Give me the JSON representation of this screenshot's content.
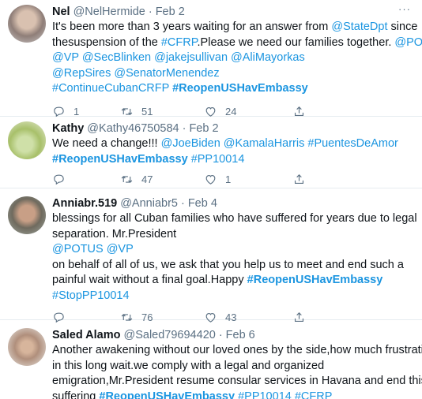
{
  "tweets": [
    {
      "name": "Nel",
      "handle": "@NelHermide",
      "date": "Feb 2",
      "lines": [
        [
          {
            "t": "It's been more than 3 years waiting for an answer from ",
            "s": "plain"
          },
          {
            "t": "@StateDpt",
            "s": "link"
          },
          {
            "t": " since",
            "s": "plain"
          }
        ],
        [
          {
            "t": "thesuspension of the ",
            "s": "plain"
          },
          {
            "t": "#CFRP",
            "s": "link"
          },
          {
            "t": ".Please we need our families together. ",
            "s": "plain"
          },
          {
            "t": "@POTUS",
            "s": "link"
          }
        ],
        [
          {
            "t": "@VP @SecBlinken @jakejsullivan @AliMayorkas",
            "s": "link"
          }
        ],
        [
          {
            "t": "@RepSires @SenatorMenendez",
            "s": "link"
          }
        ],
        [
          {
            "t": "#ContinueCubanCRFP ",
            "s": "link"
          },
          {
            "t": "#ReopenUSHavEmbassy",
            "s": "linkbold"
          }
        ]
      ],
      "replies": "1",
      "retweets": "51",
      "likes": "24"
    },
    {
      "name": "Kathy",
      "handle": "@Kathy46750584",
      "date": "Feb 2",
      "lines": [
        [
          {
            "t": "We need a change!!! ",
            "s": "plain"
          },
          {
            "t": "@JoeBiden @KamalaHarris #PuentesDeAmor",
            "s": "link"
          }
        ],
        [
          {
            "t": "#ReopenUSHavEmbassy",
            "s": "linkbold"
          },
          {
            "t": " #PP10014",
            "s": "link"
          }
        ]
      ],
      "replies": "",
      "retweets": "47",
      "likes": "1"
    },
    {
      "name": "Anniabr.519",
      "handle": "@Anniabr5",
      "date": "Feb 4",
      "lines": [
        [
          {
            "t": "blessings for all Cuban families who have suffered for years due to legal",
            "s": "plain"
          }
        ],
        [
          {
            "t": "separation. Mr.President",
            "s": "plain"
          }
        ],
        [
          {
            "t": "@POTUS    @VP",
            "s": "link"
          }
        ],
        [
          {
            "t": " on behalf of all of us, we ask that you help us to meet and end such a",
            "s": "plain"
          }
        ],
        [
          {
            "t": "painful wait without a final goal.Happy ",
            "s": "plain"
          },
          {
            "t": "#ReopenUSHavEmbassy",
            "s": "linkbold"
          }
        ],
        [
          {
            "t": "#StopPP10014",
            "s": "link"
          }
        ]
      ],
      "replies": "",
      "retweets": "76",
      "likes": "43"
    },
    {
      "name": "Saled Alamo",
      "handle": "@Saled79694420",
      "date": "Feb 6",
      "lines": [
        [
          {
            "t": "Another awakening without our loved ones by the side,how much frustration",
            "s": "plain"
          }
        ],
        [
          {
            "t": "in this long wait.we comply with a legal and organized",
            "s": "plain"
          }
        ],
        [
          {
            "t": "emigration,Mr.President resume consular services in Havana and end this",
            "s": "plain"
          }
        ],
        [
          {
            "t": "suffering ",
            "s": "plain"
          },
          {
            "t": "#ReopenUSHavEmbassy",
            "s": "linkbold"
          },
          {
            "t": " #PP10014 #CFRP",
            "s": "link"
          }
        ]
      ],
      "replies": "",
      "retweets": "",
      "likes": ""
    }
  ],
  "ui": {
    "separator": "·",
    "more_glyph": "···",
    "colors": {
      "link": "#1b95e0",
      "muted": "#5b7083",
      "text": "#0f1419",
      "border": "#e6ecf0"
    },
    "icons": [
      "reply-icon",
      "retweet-icon",
      "like-icon",
      "share-icon",
      "more-icon"
    ]
  }
}
